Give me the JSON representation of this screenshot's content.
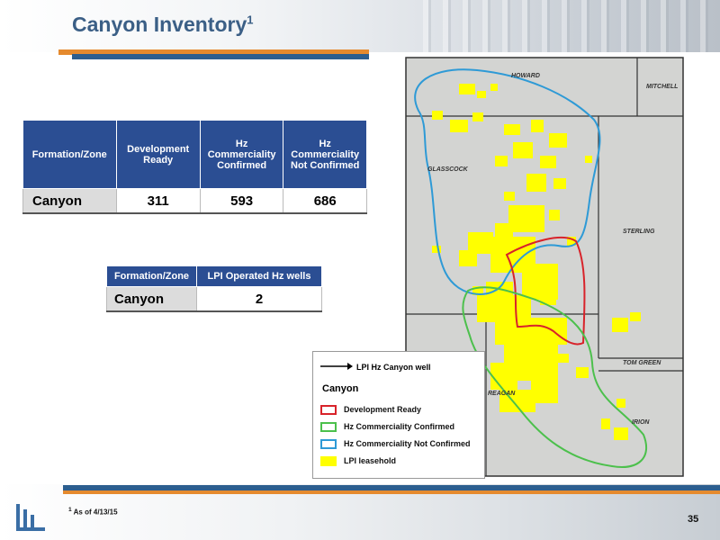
{
  "slide": {
    "title": "Canyon Inventory",
    "title_sup": "1",
    "page_number": "35",
    "footnote_sup": "1",
    "footnote_text": "As of 4/13/15"
  },
  "table1": {
    "headers": [
      "Formation/Zone",
      "Development Ready",
      "Hz Commerciality Confirmed",
      "Hz Commerciality Not Confirmed"
    ],
    "row": [
      "Canyon",
      "311",
      "593",
      "686"
    ]
  },
  "table2": {
    "headers": [
      "Formation/Zone",
      "LPI Operated Hz wells"
    ],
    "row": [
      "Canyon",
      "2"
    ]
  },
  "map": {
    "counties": [
      "HOWARD",
      "MITCHELL",
      "GLASSCOCK",
      "STERLING",
      "TOM GREEN",
      "REAGAN",
      "IRION"
    ]
  },
  "legend": {
    "arrow_label": "LPI Hz Canyon well",
    "heading": "Canyon",
    "items": [
      {
        "label": "Development Ready",
        "color": "#d8232a",
        "style": "outline"
      },
      {
        "label": "Hz Commerciality Confirmed",
        "color": "#4cc04c",
        "style": "outline"
      },
      {
        "label": "Hz Commerciality Not Confirmed",
        "color": "#2e9ad6",
        "style": "outline"
      },
      {
        "label": "LPI leasehold",
        "color": "#ffff00",
        "style": "fill"
      }
    ]
  },
  "colors": {
    "title": "#3b5f86",
    "header_blue": "#2b4e93",
    "accent_orange": "#e58a2e",
    "leasehold": "#ffff00"
  }
}
